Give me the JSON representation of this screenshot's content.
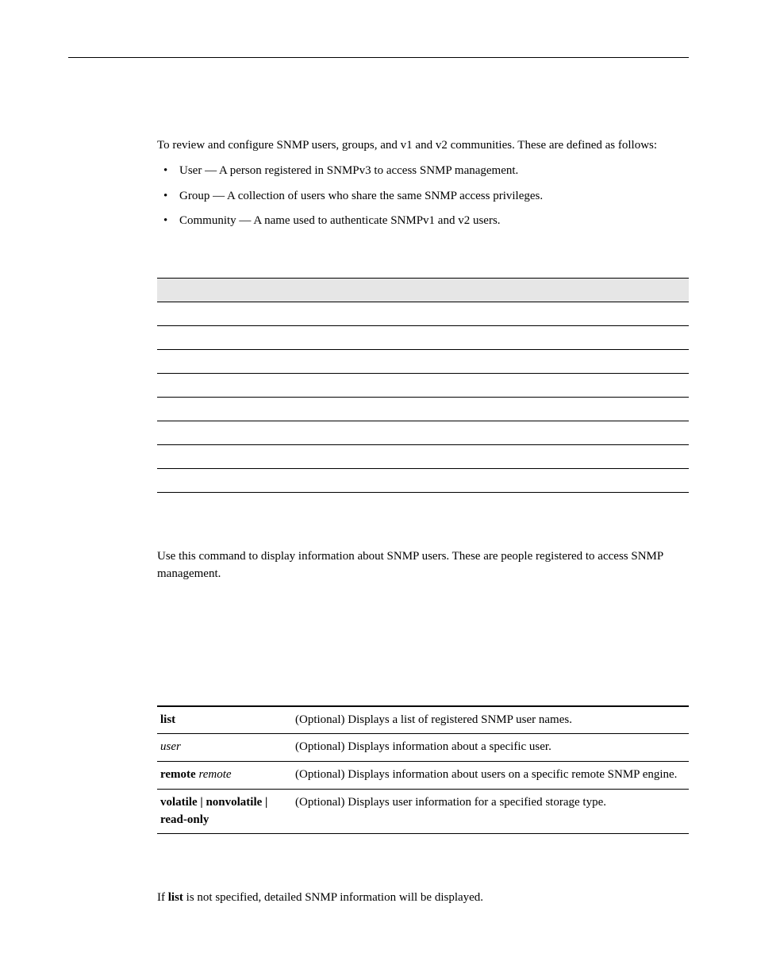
{
  "intro": {
    "lead": "To review and configure SNMP users, groups, and v1 and v2 communities. These are defined as follows:",
    "bullets": [
      "User — A person registered in SNMPv3 to access SNMP management.",
      "Group — A collection of users who share the same SNMP access privileges.",
      "Community — A name used to authenticate SNMPv1 and v2 users."
    ]
  },
  "cmd_desc": "Use this command to display information about SNMP users. These are people registered to access SNMP management.",
  "params": [
    {
      "p_bold": "list",
      "p_ital": "",
      "d": "(Optional) Displays a list of registered SNMP user names."
    },
    {
      "p_bold": "",
      "p_ital": "user",
      "d": "(Optional) Displays information about a specific user."
    },
    {
      "p_bold": "remote",
      "p_ital": " remote",
      "d": "(Optional) Displays information about users on a specific remote SNMP engine."
    },
    {
      "p_bold": "volatile | nonvolatile | read-only",
      "p_ital": "",
      "d": "(Optional) Displays user information for a specified storage type."
    }
  ],
  "defaults_pre": "If ",
  "defaults_bold": "list",
  "defaults_post": " is not specified, detailed SNMP information will be displayed."
}
